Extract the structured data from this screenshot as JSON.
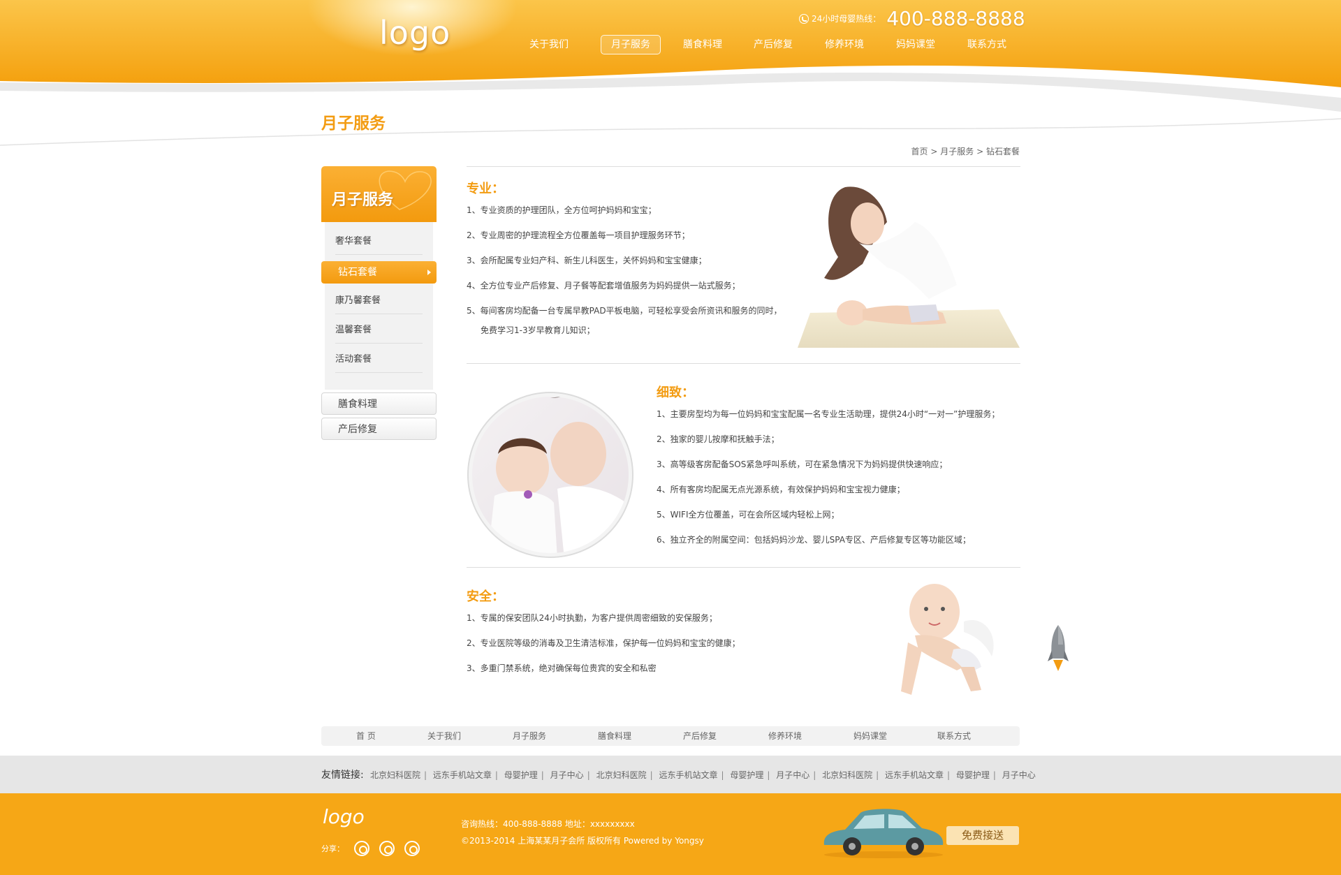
{
  "header": {
    "logo": "logo",
    "hotline_label": "24小时母婴热线：",
    "hotline_number": "400-888-8888",
    "nav": [
      "关于我们",
      "月子服务",
      "膳食料理",
      "产后修复",
      "修养环境",
      "妈妈课堂",
      "联系方式"
    ],
    "active_nav": "月子服务"
  },
  "page": {
    "title": "月子服务",
    "breadcrumb": [
      "首页",
      "月子服务",
      "钻石套餐"
    ],
    "breadcrumb_sep": ">"
  },
  "sidebar": {
    "title": "月子服务",
    "items": [
      "奢华套餐",
      "钻石套餐",
      "康乃馨套餐",
      "温馨套餐",
      "活动套餐"
    ],
    "active_item": "钻石套餐",
    "other_sections": [
      "膳食料理",
      "产后修复"
    ]
  },
  "sections": [
    {
      "title": "专业：",
      "items": [
        "1、专业资质的护理团队，全方位呵护妈妈和宝宝；",
        "2、专业周密的护理流程全方位覆盖每一项目护理服务环节；",
        "3、会所配属专业妇产科、新生儿科医生，关怀妈妈和宝宝健康；",
        "4、全方位专业产后修复、月子餐等配套增值服务为妈妈提供一站式服务；",
        "5、每间客房均配备一台专属早教PAD平板电脑，可轻松享受会所资讯和服务的同时，",
        "免费学习1-3岁早教育儿知识；"
      ]
    },
    {
      "title": "细致：",
      "items": [
        "1、主要房型均为每一位妈妈和宝宝配属一名专业生活助理，提供24小时“一对一”护理服务；",
        "2、独家的婴儿按摩和抚触手法；",
        "3、高等级客房配备SOS紧急呼叫系统，可在紧急情况下为妈妈提供快速响应；",
        "4、所有客房均配属无点光源系统，有效保护妈妈和宝宝视力健康；",
        "5、WIFI全方位覆盖，可在会所区域内轻松上网；",
        "6、独立齐全的附属空间：包括妈妈沙龙、婴儿SPA专区、产后修复专区等功能区域；"
      ]
    },
    {
      "title": "安全：",
      "items": [
        "1、专属的保安团队24小时执勤，为客户提供周密细致的安保服务；",
        "2、专业医院等级的消毒及卫生清洁标准，保护每一位妈妈和宝宝的健康；",
        "3、多重门禁系统，绝对确保每位贵宾的安全和私密"
      ]
    }
  ],
  "footer_nav": [
    "首 页",
    "关于我们",
    "月子服务",
    "膳食料理",
    "产后修复",
    "修养环境",
    "妈妈课堂",
    "联系方式"
  ],
  "friend_links": {
    "label": "友情链接:",
    "links": [
      "北京妇科医院",
      "远东手机站文章",
      "母婴护理",
      "月子中心",
      "北京妇科医院",
      "远东手机站文章",
      "母婴护理",
      "月子中心",
      "北京妇科医院",
      "远东手机站文章",
      "母婴护理",
      "月子中心"
    ]
  },
  "footer": {
    "logo": "logo",
    "share_label": "分享：",
    "contact": "咨询热线：400-888-8888 地址：xxxxxxxxx",
    "copyright": "©2013-2014 上海某某月子会所  版权所有 Powered by Yongsy",
    "shuttle_button": "免费接送"
  },
  "colors": {
    "accent": "#f39c12",
    "header_orange": "#f7a414",
    "footer_orange": "#f6a716"
  }
}
